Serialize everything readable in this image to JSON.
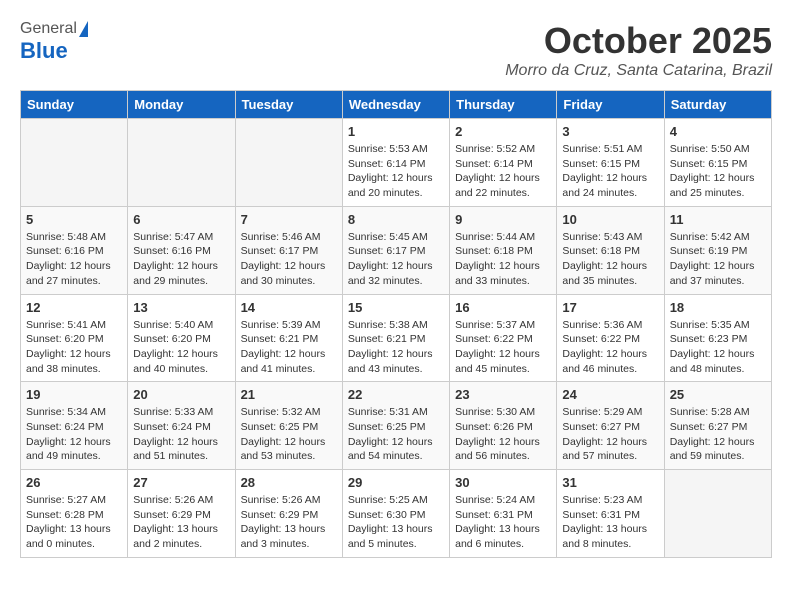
{
  "header": {
    "logo": {
      "general": "General",
      "blue": "Blue"
    },
    "title": "October 2025",
    "location": "Morro da Cruz, Santa Catarina, Brazil"
  },
  "weekdays": [
    "Sunday",
    "Monday",
    "Tuesday",
    "Wednesday",
    "Thursday",
    "Friday",
    "Saturday"
  ],
  "weeks": [
    [
      {
        "day": "",
        "info": ""
      },
      {
        "day": "",
        "info": ""
      },
      {
        "day": "",
        "info": ""
      },
      {
        "day": "1",
        "info": "Sunrise: 5:53 AM\nSunset: 6:14 PM\nDaylight: 12 hours\nand 20 minutes."
      },
      {
        "day": "2",
        "info": "Sunrise: 5:52 AM\nSunset: 6:14 PM\nDaylight: 12 hours\nand 22 minutes."
      },
      {
        "day": "3",
        "info": "Sunrise: 5:51 AM\nSunset: 6:15 PM\nDaylight: 12 hours\nand 24 minutes."
      },
      {
        "day": "4",
        "info": "Sunrise: 5:50 AM\nSunset: 6:15 PM\nDaylight: 12 hours\nand 25 minutes."
      }
    ],
    [
      {
        "day": "5",
        "info": "Sunrise: 5:48 AM\nSunset: 6:16 PM\nDaylight: 12 hours\nand 27 minutes."
      },
      {
        "day": "6",
        "info": "Sunrise: 5:47 AM\nSunset: 6:16 PM\nDaylight: 12 hours\nand 29 minutes."
      },
      {
        "day": "7",
        "info": "Sunrise: 5:46 AM\nSunset: 6:17 PM\nDaylight: 12 hours\nand 30 minutes."
      },
      {
        "day": "8",
        "info": "Sunrise: 5:45 AM\nSunset: 6:17 PM\nDaylight: 12 hours\nand 32 minutes."
      },
      {
        "day": "9",
        "info": "Sunrise: 5:44 AM\nSunset: 6:18 PM\nDaylight: 12 hours\nand 33 minutes."
      },
      {
        "day": "10",
        "info": "Sunrise: 5:43 AM\nSunset: 6:18 PM\nDaylight: 12 hours\nand 35 minutes."
      },
      {
        "day": "11",
        "info": "Sunrise: 5:42 AM\nSunset: 6:19 PM\nDaylight: 12 hours\nand 37 minutes."
      }
    ],
    [
      {
        "day": "12",
        "info": "Sunrise: 5:41 AM\nSunset: 6:20 PM\nDaylight: 12 hours\nand 38 minutes."
      },
      {
        "day": "13",
        "info": "Sunrise: 5:40 AM\nSunset: 6:20 PM\nDaylight: 12 hours\nand 40 minutes."
      },
      {
        "day": "14",
        "info": "Sunrise: 5:39 AM\nSunset: 6:21 PM\nDaylight: 12 hours\nand 41 minutes."
      },
      {
        "day": "15",
        "info": "Sunrise: 5:38 AM\nSunset: 6:21 PM\nDaylight: 12 hours\nand 43 minutes."
      },
      {
        "day": "16",
        "info": "Sunrise: 5:37 AM\nSunset: 6:22 PM\nDaylight: 12 hours\nand 45 minutes."
      },
      {
        "day": "17",
        "info": "Sunrise: 5:36 AM\nSunset: 6:22 PM\nDaylight: 12 hours\nand 46 minutes."
      },
      {
        "day": "18",
        "info": "Sunrise: 5:35 AM\nSunset: 6:23 PM\nDaylight: 12 hours\nand 48 minutes."
      }
    ],
    [
      {
        "day": "19",
        "info": "Sunrise: 5:34 AM\nSunset: 6:24 PM\nDaylight: 12 hours\nand 49 minutes."
      },
      {
        "day": "20",
        "info": "Sunrise: 5:33 AM\nSunset: 6:24 PM\nDaylight: 12 hours\nand 51 minutes."
      },
      {
        "day": "21",
        "info": "Sunrise: 5:32 AM\nSunset: 6:25 PM\nDaylight: 12 hours\nand 53 minutes."
      },
      {
        "day": "22",
        "info": "Sunrise: 5:31 AM\nSunset: 6:25 PM\nDaylight: 12 hours\nand 54 minutes."
      },
      {
        "day": "23",
        "info": "Sunrise: 5:30 AM\nSunset: 6:26 PM\nDaylight: 12 hours\nand 56 minutes."
      },
      {
        "day": "24",
        "info": "Sunrise: 5:29 AM\nSunset: 6:27 PM\nDaylight: 12 hours\nand 57 minutes."
      },
      {
        "day": "25",
        "info": "Sunrise: 5:28 AM\nSunset: 6:27 PM\nDaylight: 12 hours\nand 59 minutes."
      }
    ],
    [
      {
        "day": "26",
        "info": "Sunrise: 5:27 AM\nSunset: 6:28 PM\nDaylight: 13 hours\nand 0 minutes."
      },
      {
        "day": "27",
        "info": "Sunrise: 5:26 AM\nSunset: 6:29 PM\nDaylight: 13 hours\nand 2 minutes."
      },
      {
        "day": "28",
        "info": "Sunrise: 5:26 AM\nSunset: 6:29 PM\nDaylight: 13 hours\nand 3 minutes."
      },
      {
        "day": "29",
        "info": "Sunrise: 5:25 AM\nSunset: 6:30 PM\nDaylight: 13 hours\nand 5 minutes."
      },
      {
        "day": "30",
        "info": "Sunrise: 5:24 AM\nSunset: 6:31 PM\nDaylight: 13 hours\nand 6 minutes."
      },
      {
        "day": "31",
        "info": "Sunrise: 5:23 AM\nSunset: 6:31 PM\nDaylight: 13 hours\nand 8 minutes."
      },
      {
        "day": "",
        "info": ""
      }
    ]
  ]
}
